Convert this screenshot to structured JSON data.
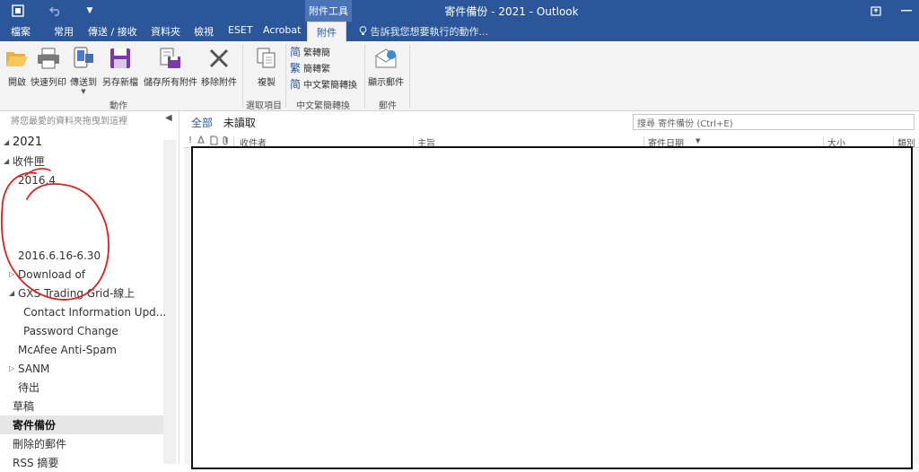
{
  "titlebar": {
    "context_group": "附件工具",
    "title": "寄件備份 - 2021 - Outlook"
  },
  "menu": {
    "tabs": [
      "檔案",
      "常用",
      "傳送 / 接收",
      "資料夾",
      "檢視",
      "ESET",
      "Acrobat"
    ],
    "active_tab": "附件",
    "tell_me": "告訴我您想要執行的動作..."
  },
  "ribbon": {
    "actions": {
      "buttons": [
        "開啟",
        "快速列印",
        "傳送到",
        "另存新檔",
        "儲存所有附件",
        "移除附件"
      ],
      "group": "動作"
    },
    "select": {
      "button": "複製",
      "group": "選取項目"
    },
    "chinese": {
      "items": [
        "繁轉簡",
        "簡轉繁",
        "中文繁簡轉換"
      ],
      "group": "中文繁簡轉換"
    },
    "message": {
      "button": "顯示郵件",
      "group": "郵件"
    }
  },
  "folderpane": {
    "favorites_hint": "將您最愛的資料夾拖曳到這裡",
    "items": [
      {
        "label": "2021"
      },
      {
        "label": "收件匣"
      },
      {
        "label": "2016.4"
      },
      {
        "label": "2016.6.16-6.30"
      },
      {
        "label": "Download of"
      },
      {
        "label": "GXS Trading Grid-線上"
      },
      {
        "label": "Contact Information Upd..."
      },
      {
        "label": "Password Change"
      },
      {
        "label": "McAfee Anti-Spam"
      },
      {
        "label": "SANM"
      },
      {
        "label": "待出"
      },
      {
        "label": "草稿"
      },
      {
        "label": "寄件備份"
      },
      {
        "label": "刪除的郵件"
      },
      {
        "label": "RSS 摘要"
      }
    ]
  },
  "mail": {
    "filter_all": "全部",
    "filter_unread": "未讀取",
    "search_placeholder": "搜尋 寄件備份 (Ctrl+E)",
    "columns": {
      "importance": "!",
      "recipient": "收件者",
      "subject": "主旨",
      "sent_date": "寄件日期",
      "size": "大小",
      "category": "類別"
    }
  },
  "colors": {
    "titlebar": "#2b579a",
    "annotation": "#e0201e"
  }
}
